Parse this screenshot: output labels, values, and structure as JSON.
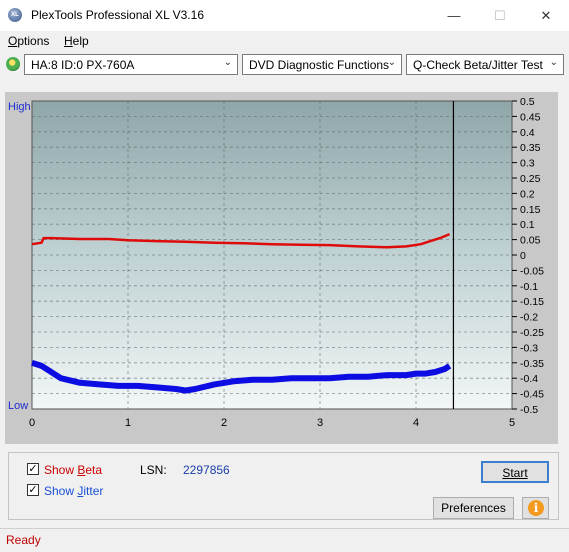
{
  "window": {
    "title": "PlexTools Professional XL V3.16",
    "app_icon_text": "XL",
    "minimize_glyph": "—",
    "maximize_glyph": "☐",
    "close_glyph": "✕"
  },
  "menu": {
    "options_first": "O",
    "options_rest": "ptions",
    "help_first": "H",
    "help_rest": "elp"
  },
  "toolbar": {
    "drive": "HA:8 ID:0  PX-760A",
    "function": "DVD Diagnostic Functions",
    "test": "Q-Check Beta/Jitter Test",
    "dropdown_glyph": "⌄"
  },
  "chart_labels": {
    "high": "High",
    "low": "Low"
  },
  "chart_data": {
    "type": "line",
    "xlim": [
      0,
      5
    ],
    "x_ticks": [
      "0",
      "1",
      "2",
      "3",
      "4",
      "5"
    ],
    "ylim": [
      -0.5,
      0.5
    ],
    "y_ticks_right": [
      "0.5",
      "0.45",
      "0.4",
      "0.35",
      "0.3",
      "0.25",
      "0.2",
      "0.15",
      "0.1",
      "0.05",
      "0",
      "-0.05",
      "-0.1",
      "-0.15",
      "-0.2",
      "-0.25",
      "-0.3",
      "-0.35",
      "-0.4",
      "-0.45",
      "-0.5"
    ],
    "grid": true,
    "end_marker_x": 4.39,
    "series": [
      {
        "color": "#e00000",
        "x": [
          0.0,
          0.1,
          0.12,
          0.2,
          0.5,
          0.8,
          1.0,
          1.3,
          1.6,
          1.9,
          2.2,
          2.5,
          2.8,
          3.1,
          3.4,
          3.7,
          3.9,
          4.05,
          4.15,
          4.25,
          4.35
        ],
        "values": [
          0.035,
          0.04,
          0.055,
          0.055,
          0.052,
          0.052,
          0.048,
          0.045,
          0.043,
          0.04,
          0.038,
          0.035,
          0.033,
          0.032,
          0.028,
          0.025,
          0.028,
          0.035,
          0.045,
          0.055,
          0.068
        ]
      },
      {
        "color": "#0000e0",
        "x": [
          0.0,
          0.1,
          0.2,
          0.3,
          0.5,
          0.7,
          0.9,
          1.1,
          1.3,
          1.5,
          1.6,
          1.7,
          1.9,
          2.1,
          2.3,
          2.5,
          2.7,
          2.9,
          3.1,
          3.3,
          3.5,
          3.7,
          3.9,
          4.0,
          4.1,
          4.2,
          4.3,
          4.35
        ],
        "values": [
          -0.35,
          -0.36,
          -0.38,
          -0.4,
          -0.415,
          -0.42,
          -0.425,
          -0.425,
          -0.43,
          -0.435,
          -0.44,
          -0.435,
          -0.42,
          -0.41,
          -0.405,
          -0.405,
          -0.4,
          -0.4,
          -0.4,
          -0.395,
          -0.395,
          -0.39,
          -0.39,
          -0.385,
          -0.385,
          -0.38,
          -0.37,
          -0.36
        ]
      }
    ]
  },
  "bottom": {
    "show_beta_pre": "Show ",
    "show_beta_u": "B",
    "show_beta_post": "eta",
    "show_jitter_pre": "Show ",
    "show_jitter_u": "J",
    "show_jitter_post": "itter",
    "lsn_label": "LSN:",
    "lsn_value": "2297856",
    "start": "Start",
    "preferences": "Preferences",
    "info_glyph": "i",
    "check_glyph": "✓",
    "beta_color": "#cc0000",
    "jitter_color": "#1a4fd6"
  },
  "status": {
    "text": "Ready"
  }
}
